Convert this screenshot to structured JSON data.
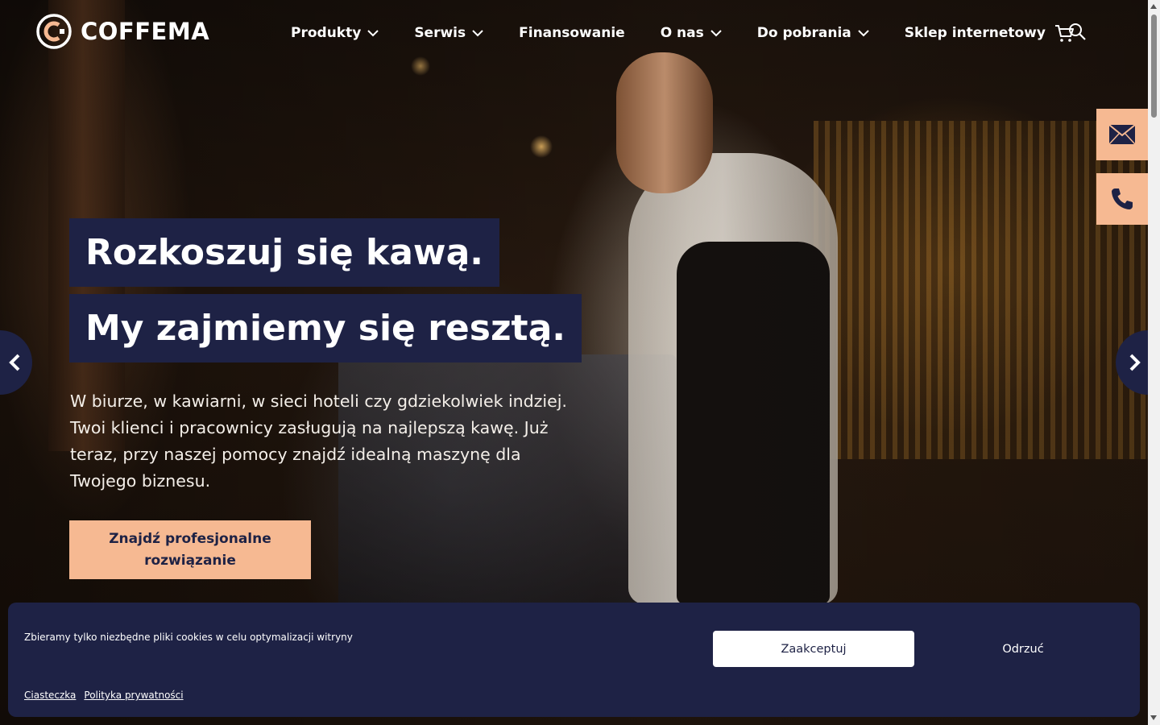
{
  "brand": {
    "name": "COFFEMA",
    "accent": "#f6b992",
    "navy": "#1e2245"
  },
  "nav": {
    "items": [
      {
        "label": "Produkty",
        "dropdown": true
      },
      {
        "label": "Serwis",
        "dropdown": true
      },
      {
        "label": "Finansowanie",
        "dropdown": false
      },
      {
        "label": "O nas",
        "dropdown": true
      },
      {
        "label": "Do pobrania",
        "dropdown": true
      },
      {
        "label": "Sklep internetowy",
        "dropdown": false,
        "icon": "cart-icon"
      }
    ],
    "search_icon": "search-icon"
  },
  "side_contacts": {
    "mail_icon": "mail-icon",
    "phone_icon": "phone-icon"
  },
  "slider": {
    "prev_icon": "chevron-left-icon",
    "next_icon": "chevron-right-icon"
  },
  "hero": {
    "headline_1": "Rozkoszuj się kawą.",
    "headline_2": "My zajmiemy się resztą.",
    "lead": "W biurze, w kawiarni, w sieci hoteli czy gdziekolwiek indziej. Twoi klienci i pracownicy zasługują na najlepszą kawę. Już teraz, przy naszej pomocy znajdź idealną maszynę dla Twojego biznesu.",
    "cta_label": "Znajdź profesjonalne rozwiązanie"
  },
  "cookie_banner": {
    "message": "Zbieramy tylko niezbędne pliki cookies w celu optymalizacji witryny",
    "accept_label": "Zaakceptuj",
    "reject_label": "Odrzuć",
    "links": [
      "Ciasteczka",
      "Polityka prywatności"
    ]
  }
}
